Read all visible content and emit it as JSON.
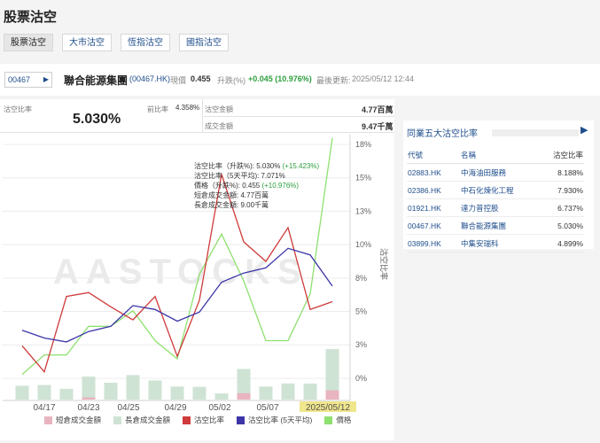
{
  "page_title": "股票沽空",
  "tabs": [
    "股票沽空",
    "大市沽空",
    "恆指沽空",
    "國指沽空"
  ],
  "stock": {
    "code": "00467",
    "name": "聯合能源集團",
    "code_hk": "(00467.HK)",
    "price_label": "現價",
    "price": "0.455",
    "change_label": "升跌(%)",
    "change": "+0.045 (10.976%)",
    "updated_label": "最後更新:",
    "updated": "2025/05/12 12:44"
  },
  "stats": {
    "short_ratio_label": "沽空比率",
    "short_ratio": "5.030%",
    "prev_ratio_label": "前比率",
    "prev_ratio": "4.358%",
    "short_amount_label": "沽空金額",
    "short_amount": "4.77百萬",
    "turnover_label": "成交金額",
    "turnover": "9.47千萬"
  },
  "tooltip": {
    "ratio_line": "沽空比率（升跌%): 5.030% ",
    "ratio_change": "(+15.423%)",
    "ratio5": "沽空比率（5天平均): 7.071%",
    "price_line": "價格（升跌%): 0.455 ",
    "price_change": "(+10.976%)",
    "short_pos": "短倉成交金額: 4.77百萬",
    "long_pos": "長倉成交金額: 9.00千萬"
  },
  "watermark": "AASTOCKS",
  "side": {
    "title": "同業五大沽空比率",
    "headers": [
      "代號",
      "名稱",
      "沽空比率"
    ],
    "rows": [
      {
        "code": "02883.HK",
        "name": "中海油田服務",
        "ratio": "8.188%"
      },
      {
        "code": "02386.HK",
        "name": "中石化煉化工程",
        "ratio": "7.930%"
      },
      {
        "code": "01921.HK",
        "name": "達力普控股",
        "ratio": "6.737%"
      },
      {
        "code": "00467.HK",
        "name": "聯合能源集團",
        "ratio": "5.030%"
      },
      {
        "code": "03899.HK",
        "name": "中集安瑞科",
        "ratio": "4.899%"
      }
    ]
  },
  "legend": [
    "短倉成交金額",
    "長倉成交金額",
    "沽空比率",
    "沽空比率 (5天平均)",
    "價格"
  ],
  "colors": {
    "short_bar": "#e8b4bf",
    "long_bar": "#cfe3d5",
    "ratio": "#cf3a3a",
    "ratio5": "#3c35a8",
    "price": "#8ee06e",
    "accent": "#1f4e8c"
  },
  "chart_data": {
    "type": "line",
    "x_ticks": [
      "04/17",
      "04/23",
      "04/25",
      "04/29",
      "05/02",
      "05/07",
      "2025/05/12"
    ],
    "y_right_ticks": [
      "18%",
      "15%",
      "13%",
      "10%",
      "8%",
      "5%",
      "3%",
      "0%"
    ],
    "y_axis_label": "沽空比率",
    "ratio_pct": [
      2.5,
      0.5,
      6.3,
      6.6,
      5.5,
      4.5,
      6.3,
      1.7,
      6.0,
      15.7,
      10.5,
      9.0,
      11.6,
      5.3,
      5.9
    ],
    "ratio5_pct": [
      3.7,
      3.1,
      2.8,
      3.6,
      4.0,
      5.6,
      5.3,
      4.4,
      5.1,
      7.4,
      8.1,
      8.5,
      10.0,
      9.5,
      7.1
    ],
    "price_index": [
      0.3,
      1.8,
      1.8,
      4.0,
      4.0,
      5.2,
      2.9,
      1.5,
      8.0,
      11.1,
      7.5,
      2.9,
      2.9,
      6.5,
      18.5
    ],
    "long_bars": [
      9.0,
      9.5,
      7.0,
      15.0,
      11.0,
      16.0,
      12.5,
      8.5,
      8.3,
      4.0,
      20.0,
      8.5,
      10.5,
      10.5,
      33.0
    ],
    "short_bars": [
      0,
      0,
      0,
      0.6,
      0,
      0,
      0,
      0,
      0,
      0,
      1.8,
      0,
      0,
      0,
      2.6
    ]
  }
}
